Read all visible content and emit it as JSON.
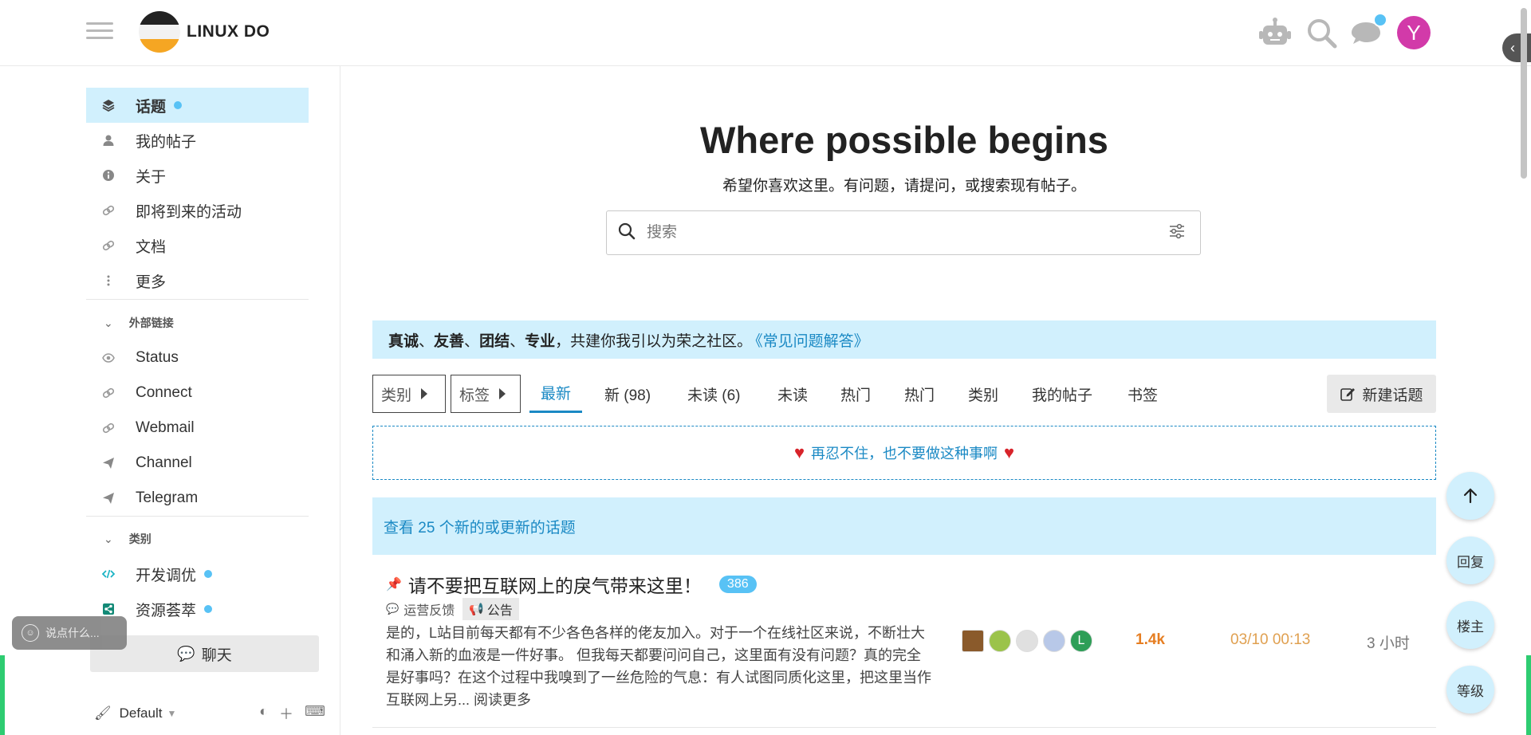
{
  "header": {
    "brand": "LINUX DO",
    "avatar_letter": "Y",
    "avatar_color": "#d23aa9",
    "icons": [
      "robot-icon",
      "search-icon",
      "chat-bubble-icon"
    ]
  },
  "sidebar": {
    "items": [
      {
        "label": "话题",
        "icon": "layers-icon",
        "dot": true
      },
      {
        "label": "我的帖子",
        "icon": "user-icon"
      },
      {
        "label": "关于",
        "icon": "info-icon"
      },
      {
        "label": "即将到来的活动",
        "icon": "link-icon"
      },
      {
        "label": "文档",
        "icon": "link-icon"
      },
      {
        "label": "更多",
        "icon": "more-vertical-icon"
      }
    ],
    "external_section": "外部链接",
    "external": [
      {
        "label": "Status",
        "icon": "eye-icon"
      },
      {
        "label": "Connect",
        "icon": "link-icon"
      },
      {
        "label": "Webmail",
        "icon": "link-icon"
      },
      {
        "label": "Channel",
        "icon": "send-icon"
      },
      {
        "label": "Telegram",
        "icon": "send-icon"
      }
    ],
    "category_section": "类别",
    "categories": [
      {
        "label": "开发调优",
        "icon": "code-icon",
        "dot": true
      },
      {
        "label": "资源荟萃",
        "icon": "share-icon",
        "dot": true
      }
    ],
    "chat_label": "聊天",
    "say_placeholder": "说点什么...",
    "theme_label": "Default"
  },
  "hero": {
    "title": "Where possible begins",
    "subtitle": "希望你喜欢这里。有问题，请提问，或搜索现有帖子。",
    "search_placeholder": "搜索"
  },
  "banner": {
    "w1": "真诚",
    "s1": "、",
    "w2": "友善",
    "s2": "、",
    "w3": "团结",
    "s3": "、",
    "w4": "专业",
    "rest": "，共建你我引以为荣之社区。",
    "faq": "《常见问题解答》"
  },
  "filters": {
    "category": "类别",
    "tags": "标签"
  },
  "tabs": [
    "最新",
    "新 (98)",
    "未读 (6)",
    "未读",
    "热门",
    "热门",
    "类别",
    "我的帖子",
    "书签"
  ],
  "new_topic_label": "新建话题",
  "notice": "再忍不住，也不要做这种事啊",
  "new_topics_text": "查看 25 个新的或更新的话题",
  "topic": {
    "title": "请不要把互联网上的戾气带来这里！",
    "reply_count": "386",
    "category": "运营反馈",
    "tag": "公告",
    "excerpt": "是的，L站目前每天都有不少各色各样的佬友加入。对于一个在线社区来说，不断壮大和涌入新的血液是一件好事。 但我每天都要问问自己，这里面有没有问题？真的完全是好事吗？在这个过程中我嗅到了一丝危险的气息：有人试图同质化这里，把这里当作互联网上另...",
    "read_more": "阅读更多",
    "views": "1.4k",
    "date": "03/10 00:13",
    "age": "3 小时",
    "poster_colors": [
      "#8a5a2b",
      "#9bc34a",
      "#e0e0e0",
      "#b8c8e8",
      "#2e9e57"
    ],
    "last_poster_letter": "L"
  },
  "fabs": {
    "reply": "回复",
    "owner": "楼主",
    "level": "等级"
  },
  "colors": {
    "accent": "#1a89c4",
    "highlight": "#d1f0fd",
    "dot": "#58c2f5"
  }
}
